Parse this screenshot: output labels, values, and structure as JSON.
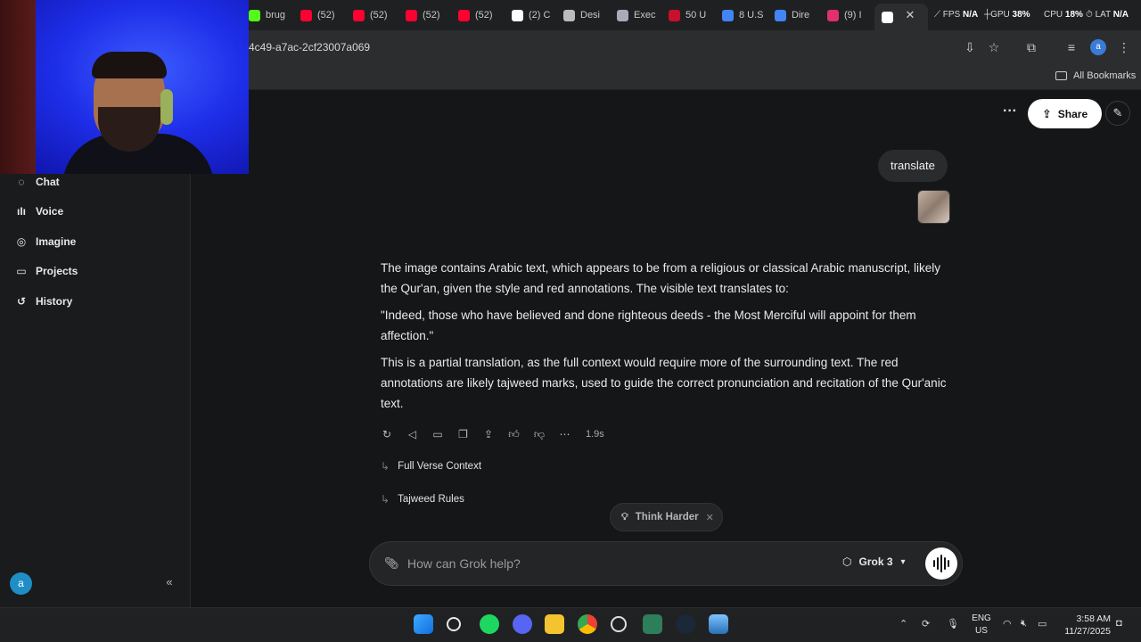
{
  "browser": {
    "tabs": [
      {
        "label": "brug",
        "icon": "kick-icon",
        "color": "#53fc18"
      },
      {
        "label": "(52)",
        "icon": "youtube-icon",
        "color": "#ff0033"
      },
      {
        "label": "(52)",
        "icon": "youtube-icon",
        "color": "#ff0033"
      },
      {
        "label": "(52)",
        "icon": "youtube-icon",
        "color": "#ff0033"
      },
      {
        "label": "(52)",
        "icon": "youtube-icon",
        "color": "#ff0033"
      },
      {
        "label": "(2) C",
        "icon": "x-icon",
        "color": "#ffffff"
      },
      {
        "label": "Desi",
        "icon": "bank-icon",
        "color": "#bbbbbb"
      },
      {
        "label": "Exec",
        "icon": "seal-icon",
        "color": "#aab"
      },
      {
        "label": "50 U",
        "icon": "news-icon",
        "color": "#c8102e"
      },
      {
        "label": "8 U.S",
        "icon": "google-icon",
        "color": "#4285f4"
      },
      {
        "label": "Dire",
        "icon": "google-icon",
        "color": "#4285f4"
      },
      {
        "label": "(9) I",
        "icon": "instagram-icon",
        "color": "#e1306c"
      },
      {
        "label": "",
        "icon": "grok-icon",
        "color": "#ffffff"
      }
    ],
    "url": "4c49-a7ac-2cf23007a069",
    "bookmarks_label": "All Bookmarks",
    "profile_initial": "a"
  },
  "perf_overlay": {
    "fps_label": "FPS",
    "fps_value": "N/A",
    "gpu_label": "GPU",
    "gpu_value": "38",
    "cpu_label": "CPU",
    "cpu_value": "18",
    "lat_label": "LAT",
    "lat_value": "N/A"
  },
  "sidebar": {
    "items": [
      {
        "label": "Chat",
        "icon": "chat-icon"
      },
      {
        "label": "Voice",
        "icon": "voice-icon"
      },
      {
        "label": "Imagine",
        "icon": "imagine-icon"
      },
      {
        "label": "Projects",
        "icon": "folder-icon"
      },
      {
        "label": "History",
        "icon": "history-icon"
      }
    ],
    "avatar_initial": "a"
  },
  "header": {
    "share_label": "Share"
  },
  "conversation": {
    "user_message": "translate",
    "answer_paragraphs": [
      "The image contains Arabic text, which appears to be from a religious or classical Arabic manuscript, likely the Qur'an, given the style and red annotations. The visible text translates to:",
      "\"Indeed, those who have believed and done righteous deeds - the Most Merciful will appoint for them affection.\"",
      "This is a partial translation, as the full context would require more of the surrounding text. The red annotations are likely tajweed marks, used to guide the correct pronunciation and recitation of the Qur'anic text."
    ],
    "response_time": "1.9s",
    "followups": [
      "Full Verse Context",
      "Tajweed Rules"
    ]
  },
  "composer": {
    "think_harder_label": "Think Harder",
    "placeholder": "How can Grok help?",
    "model_label": "Grok 3"
  },
  "taskbar": {
    "language_line1": "ENG",
    "language_line2": "US",
    "time": "3:58 AM",
    "date": "11/27/2025"
  }
}
